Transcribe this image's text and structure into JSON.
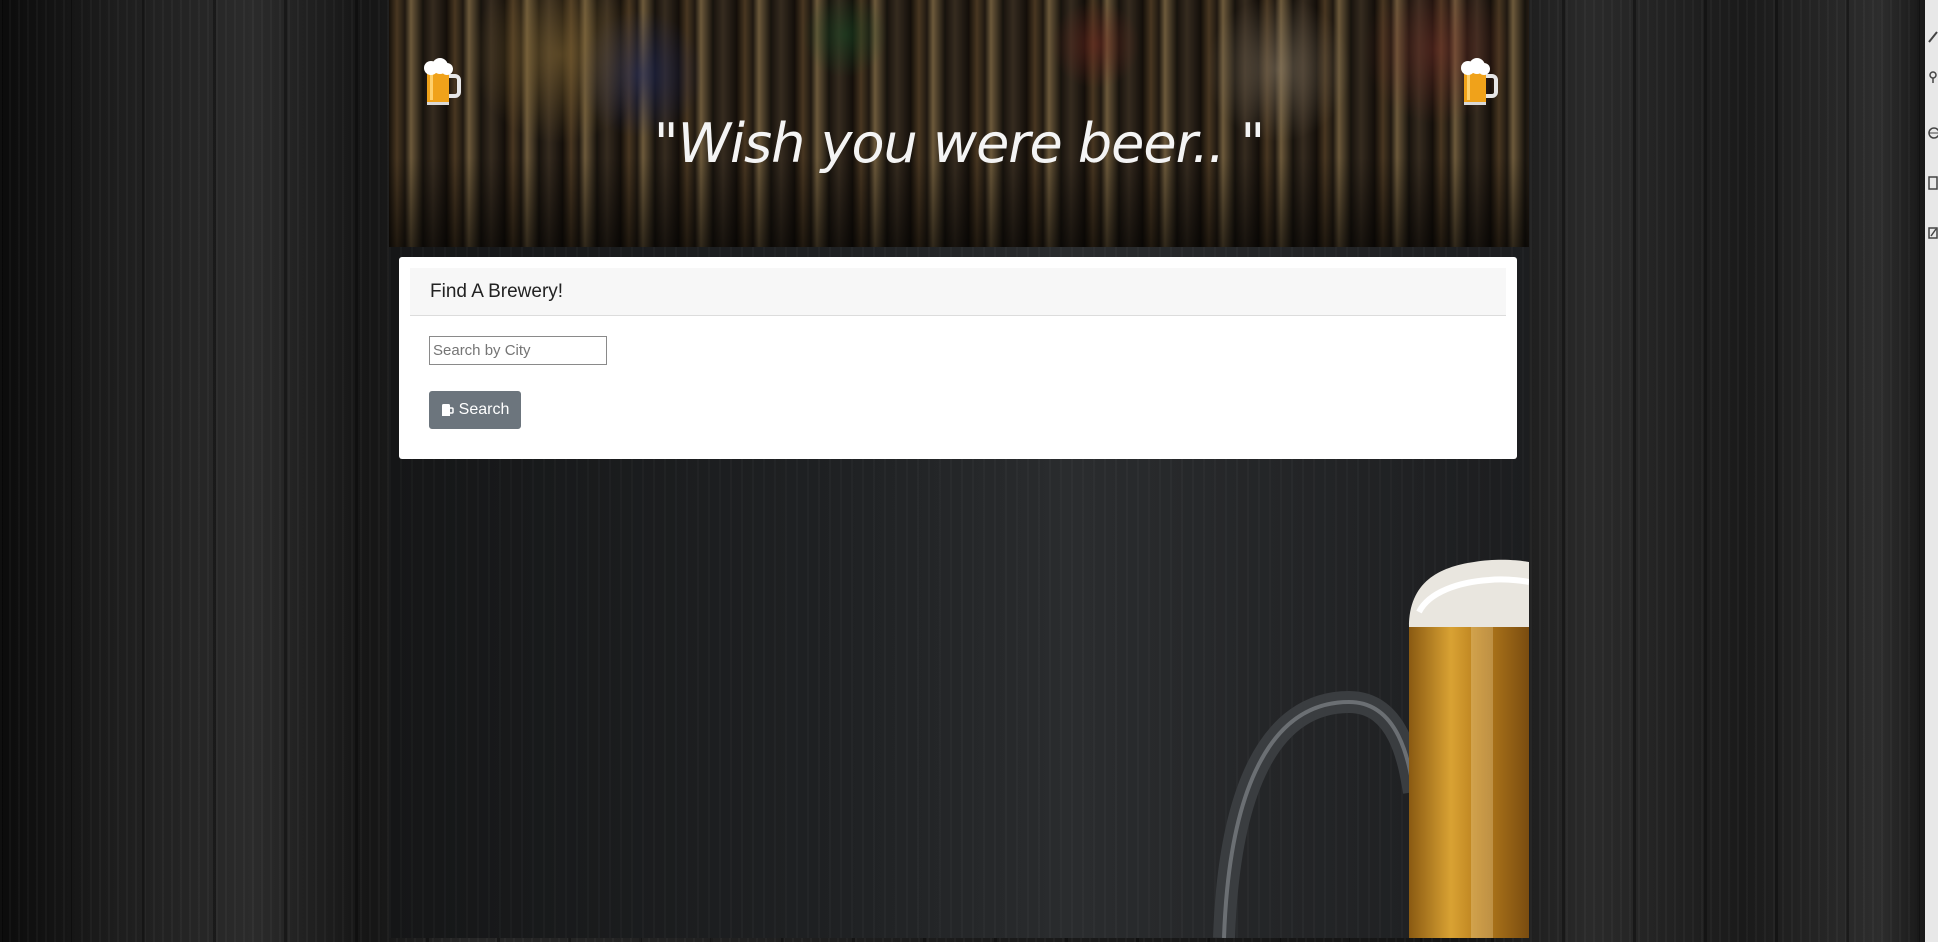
{
  "hero": {
    "tagline": "\"Wish you were beer.. \"",
    "left_icon": "beer-mug-icon",
    "right_icon": "beer-mug-icon"
  },
  "search_card": {
    "title": "Find A Brewery!",
    "city_input": {
      "placeholder": "Search by City",
      "value": ""
    },
    "search_button": {
      "label": "Search",
      "icon": "beer-icon"
    }
  },
  "colors": {
    "button_bg": "#6c757d",
    "card_bg": "#ffffff",
    "header_bg": "#f7f7f7",
    "page_bg": "#1a1a1a"
  },
  "side_toolbar": {
    "icons": [
      "pen-icon",
      "pin-icon",
      "globe-icon",
      "book-icon",
      "edit-icon"
    ]
  }
}
